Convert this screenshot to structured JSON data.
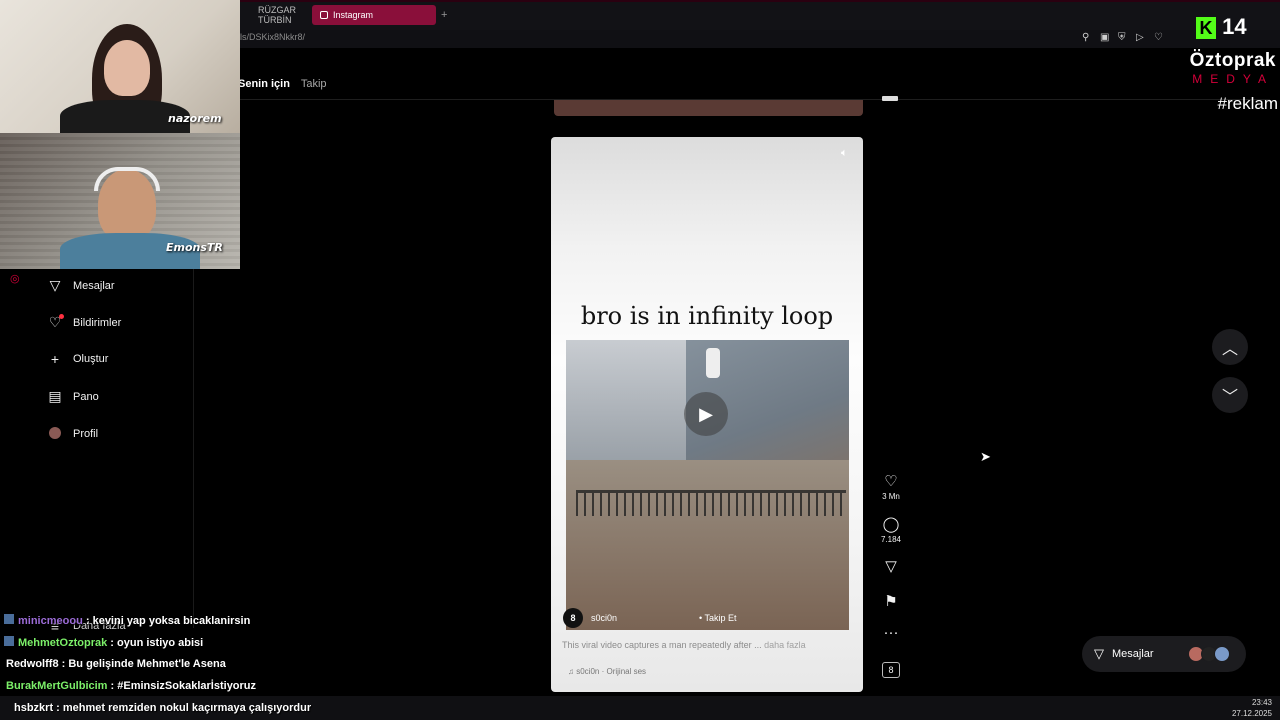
{
  "browser": {
    "tabs": [
      {
        "label": "RÜZGAR TÜRBİN"
      },
      {
        "label": "Instagram"
      }
    ],
    "new_tab": "+",
    "url": "ls/DSKix8Nkkr8/"
  },
  "feed_nav": {
    "for_you": "Senin için",
    "following": "Takip"
  },
  "sidebar": {
    "items": [
      {
        "label": "Mesajlar",
        "icon": "send-icon"
      },
      {
        "label": "Bildirimler",
        "icon": "heart-icon"
      },
      {
        "label": "Oluştur",
        "icon": "plus-icon"
      },
      {
        "label": "Pano",
        "icon": "dashboard-icon"
      },
      {
        "label": "Profil",
        "icon": "profile-icon"
      }
    ],
    "more": "Daha fazla"
  },
  "reel": {
    "caption": "bro is in infinity loop",
    "author": "s0ci0n",
    "follow": "Takip Et",
    "description": "This viral video captures a man repeatedly after ...",
    "more": "daha fazla",
    "audio": "s0ci0n · Orijinal ses"
  },
  "actions": {
    "likes": "3 Mn",
    "comments": "7.184"
  },
  "messages_button": "Mesajlar",
  "streamer_overlay": {
    "cam1_name": "nazorem",
    "cam2_name": "EmonsTR",
    "k_count": "14",
    "brand": "Öztoprak",
    "brand_sub": "MEDYA",
    "hashtag": "#reklam"
  },
  "chat": [
    {
      "user": "minicmeoou",
      "user_color": "#9b6bd6",
      "message": "kevini yap yoksa bicaklanirsin"
    },
    {
      "user": "MehmetOztoprak",
      "user_color": "#7cf069",
      "message": "oyun istiyo abisi"
    },
    {
      "user": "Redwolff8",
      "user_color": "#ffffff",
      "message": "Bu gelişinde Mehmet'le Asena"
    },
    {
      "user": "BurakMertGulbicim",
      "user_color": "#7cf069",
      "message": "#EminsizSokaklarİstiyoruz"
    },
    {
      "user": "hsbzkrt",
      "user_color": "#ffffff",
      "message": "mehmet remziden nokul kaçırmaya çalışıyordur"
    }
  ],
  "clock": {
    "time": "23:43",
    "date": "27.12.2025"
  },
  "colors": {
    "accent_tab": "#8a0f3a",
    "brand_red": "#d4003a",
    "chat_green": "#7cf069"
  }
}
